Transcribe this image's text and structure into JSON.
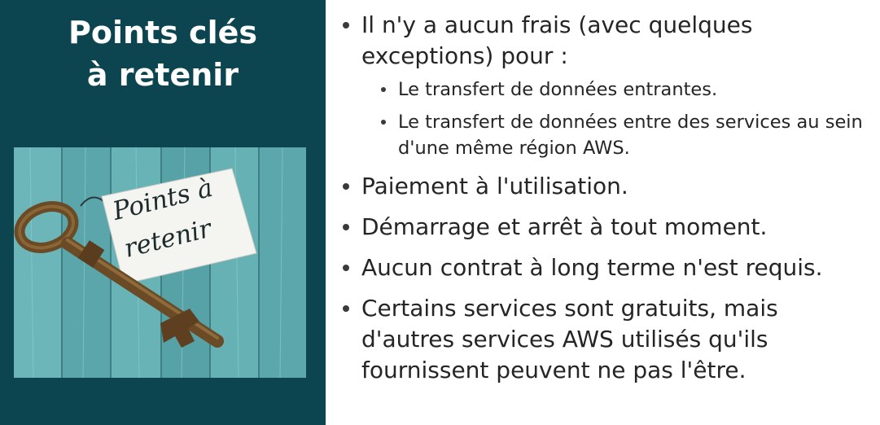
{
  "sidebar": {
    "title_line1": "Points clés",
    "title_line2": "à retenir",
    "image": {
      "tag_line1": "Points à",
      "tag_line2": "retenir",
      "background_color": "#5fa9ad",
      "key_color": "#6b4a26",
      "tag_color": "#f4f4f1"
    }
  },
  "colors": {
    "sidebar_bg": "#0c4450",
    "text": "#252525"
  },
  "bullets": {
    "b1": {
      "text": "Il n'y a aucun frais (avec quelques exceptions) pour :",
      "sub": [
        "Le transfert de données entrantes.",
        "Le transfert de données entre des services au sein d'une même région AWS."
      ]
    },
    "b2": "Paiement à l'utilisation.",
    "b3": "Démarrage et arrêt à tout moment.",
    "b4": "Aucun contrat à long terme n'est requis.",
    "b5": "Certains services sont gratuits, mais d'autres services AWS utilisés qu'ils fournissent peuvent ne pas l'être."
  }
}
